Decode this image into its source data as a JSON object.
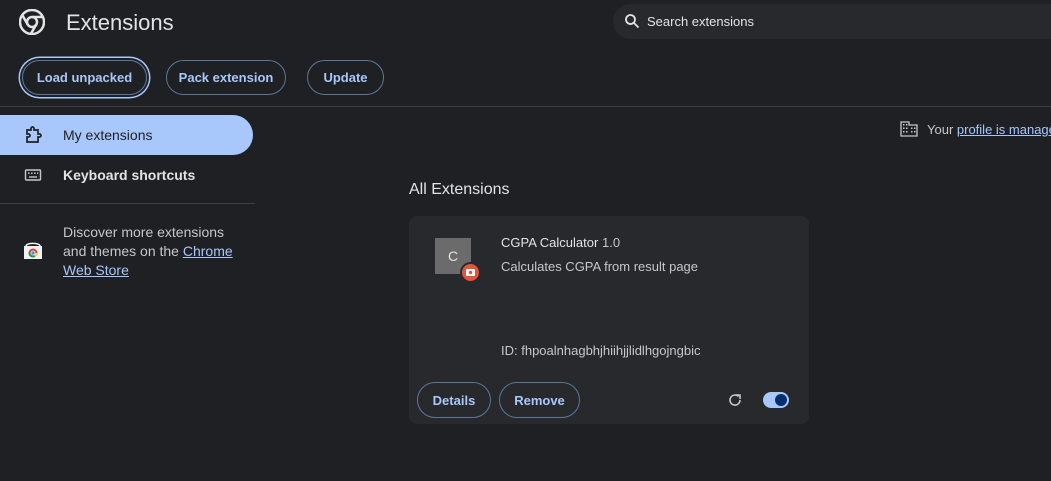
{
  "header": {
    "title": "Extensions",
    "search_placeholder": "Search extensions",
    "buttons": {
      "load_unpacked": "Load unpacked",
      "pack_extension": "Pack extension",
      "update": "Update"
    }
  },
  "sidebar": {
    "items": [
      {
        "label": "My extensions",
        "icon": "puzzle-icon"
      },
      {
        "label": "Keyboard shortcuts",
        "icon": "keyboard-icon"
      }
    ],
    "discover": {
      "text": "Discover more extensions and themes on the ",
      "link": "Chrome Web Store"
    }
  },
  "managed": {
    "prefix": "Your ",
    "link": "profile is manage"
  },
  "main": {
    "section_title": "All Extensions",
    "extension": {
      "icon_letter": "C",
      "name": "CGPA Calculator",
      "version": "1.0",
      "description": "Calculates CGPA from result page",
      "id": "ID: fhpoalnhagbhjhiihjjlidlhgojngbic",
      "details_label": "Details",
      "remove_label": "Remove",
      "enabled": true
    }
  },
  "colors": {
    "background": "#1f2023",
    "card": "#28292c",
    "accent": "#a8c7fa",
    "badge": "#e2543c"
  }
}
